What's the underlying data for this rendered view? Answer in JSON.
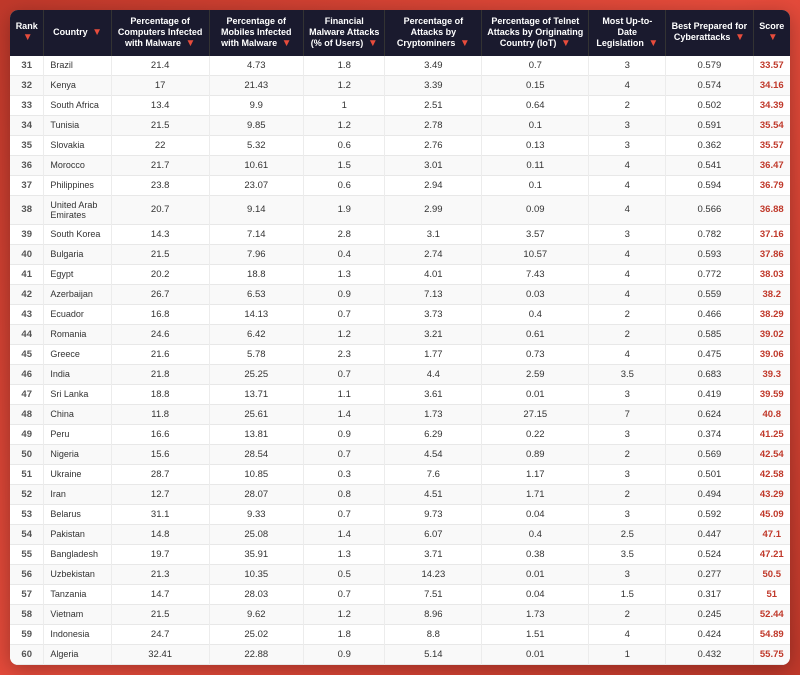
{
  "colors": {
    "header_bg": "#1a1a2e",
    "header_text": "#ffffff",
    "accent": "#e74c3c",
    "body_bg": "#ffffff",
    "alt_row": "#f9f9f9"
  },
  "columns": [
    {
      "key": "rank",
      "label": "Rank"
    },
    {
      "key": "country",
      "label": "Country"
    },
    {
      "key": "pct_malware",
      "label": "Percentage of Computers Infected with Malware"
    },
    {
      "key": "pct_mobile",
      "label": "Percentage of Mobiles Infected with Malware"
    },
    {
      "key": "fin_malware",
      "label": "Financial Malware Attacks (% of Users)"
    },
    {
      "key": "pct_cryptominer",
      "label": "Percentage of Attacks by Cryptominers"
    },
    {
      "key": "pct_telnet",
      "label": "Percentage of Telnet Attacks by Originating Country (IoT)"
    },
    {
      "key": "legislation",
      "label": "Most Up-to-Date Legislation"
    },
    {
      "key": "prepared",
      "label": "Best Prepared for Cyberattacks"
    },
    {
      "key": "score",
      "label": "Score"
    }
  ],
  "rows": [
    {
      "rank": 31,
      "country": "Brazil",
      "pct_malware": "21.4",
      "pct_mobile": "4.73",
      "fin_malware": "1.8",
      "pct_cryptominer": "3.49",
      "pct_telnet": "0.7",
      "legislation": "3",
      "prepared": "0.579",
      "score": "33.57"
    },
    {
      "rank": 32,
      "country": "Kenya",
      "pct_malware": "17",
      "pct_mobile": "21.43",
      "fin_malware": "1.2",
      "pct_cryptominer": "3.39",
      "pct_telnet": "0.15",
      "legislation": "4",
      "prepared": "0.574",
      "score": "34.16"
    },
    {
      "rank": 33,
      "country": "South Africa",
      "pct_malware": "13.4",
      "pct_mobile": "9.9",
      "fin_malware": "1",
      "pct_cryptominer": "2.51",
      "pct_telnet": "0.64",
      "legislation": "2",
      "prepared": "0.502",
      "score": "34.39"
    },
    {
      "rank": 34,
      "country": "Tunisia",
      "pct_malware": "21.5",
      "pct_mobile": "9.85",
      "fin_malware": "1.2",
      "pct_cryptominer": "2.78",
      "pct_telnet": "0.1",
      "legislation": "3",
      "prepared": "0.591",
      "score": "35.54"
    },
    {
      "rank": 35,
      "country": "Slovakia",
      "pct_malware": "22",
      "pct_mobile": "5.32",
      "fin_malware": "0.6",
      "pct_cryptominer": "2.76",
      "pct_telnet": "0.13",
      "legislation": "3",
      "prepared": "0.362",
      "score": "35.57"
    },
    {
      "rank": 36,
      "country": "Morocco",
      "pct_malware": "21.7",
      "pct_mobile": "10.61",
      "fin_malware": "1.5",
      "pct_cryptominer": "3.01",
      "pct_telnet": "0.11",
      "legislation": "4",
      "prepared": "0.541",
      "score": "36.47"
    },
    {
      "rank": 37,
      "country": "Philippines",
      "pct_malware": "23.8",
      "pct_mobile": "23.07",
      "fin_malware": "0.6",
      "pct_cryptominer": "2.94",
      "pct_telnet": "0.1",
      "legislation": "4",
      "prepared": "0.594",
      "score": "36.79"
    },
    {
      "rank": 38,
      "country": "United Arab Emirates",
      "pct_malware": "20.7",
      "pct_mobile": "9.14",
      "fin_malware": "1.9",
      "pct_cryptominer": "2.99",
      "pct_telnet": "0.09",
      "legislation": "4",
      "prepared": "0.566",
      "score": "36.88"
    },
    {
      "rank": 39,
      "country": "South Korea",
      "pct_malware": "14.3",
      "pct_mobile": "7.14",
      "fin_malware": "2.8",
      "pct_cryptominer": "3.1",
      "pct_telnet": "3.57",
      "legislation": "3",
      "prepared": "0.782",
      "score": "37.16"
    },
    {
      "rank": 40,
      "country": "Bulgaria",
      "pct_malware": "21.5",
      "pct_mobile": "7.96",
      "fin_malware": "0.4",
      "pct_cryptominer": "2.74",
      "pct_telnet": "10.57",
      "legislation": "4",
      "prepared": "0.593",
      "score": "37.86"
    },
    {
      "rank": 41,
      "country": "Egypt",
      "pct_malware": "20.2",
      "pct_mobile": "18.8",
      "fin_malware": "1.3",
      "pct_cryptominer": "4.01",
      "pct_telnet": "7.43",
      "legislation": "4",
      "prepared": "0.772",
      "score": "38.03"
    },
    {
      "rank": 42,
      "country": "Azerbaijan",
      "pct_malware": "26.7",
      "pct_mobile": "6.53",
      "fin_malware": "0.9",
      "pct_cryptominer": "7.13",
      "pct_telnet": "0.03",
      "legislation": "4",
      "prepared": "0.559",
      "score": "38.2"
    },
    {
      "rank": 43,
      "country": "Ecuador",
      "pct_malware": "16.8",
      "pct_mobile": "14.13",
      "fin_malware": "0.7",
      "pct_cryptominer": "3.73",
      "pct_telnet": "0.4",
      "legislation": "2",
      "prepared": "0.466",
      "score": "38.29"
    },
    {
      "rank": 44,
      "country": "Romania",
      "pct_malware": "24.6",
      "pct_mobile": "6.42",
      "fin_malware": "1.2",
      "pct_cryptominer": "3.21",
      "pct_telnet": "0.61",
      "legislation": "2",
      "prepared": "0.585",
      "score": "39.02"
    },
    {
      "rank": 45,
      "country": "Greece",
      "pct_malware": "21.6",
      "pct_mobile": "5.78",
      "fin_malware": "2.3",
      "pct_cryptominer": "1.77",
      "pct_telnet": "0.73",
      "legislation": "4",
      "prepared": "0.475",
      "score": "39.06"
    },
    {
      "rank": 46,
      "country": "India",
      "pct_malware": "21.8",
      "pct_mobile": "25.25",
      "fin_malware": "0.7",
      "pct_cryptominer": "4.4",
      "pct_telnet": "2.59",
      "legislation": "3.5",
      "prepared": "0.683",
      "score": "39.3"
    },
    {
      "rank": 47,
      "country": "Sri Lanka",
      "pct_malware": "18.8",
      "pct_mobile": "13.71",
      "fin_malware": "1.1",
      "pct_cryptominer": "3.61",
      "pct_telnet": "0.01",
      "legislation": "3",
      "prepared": "0.419",
      "score": "39.59"
    },
    {
      "rank": 48,
      "country": "China",
      "pct_malware": "11.8",
      "pct_mobile": "25.61",
      "fin_malware": "1.4",
      "pct_cryptominer": "1.73",
      "pct_telnet": "27.15",
      "legislation": "7",
      "prepared": "0.624",
      "score": "40.8"
    },
    {
      "rank": 49,
      "country": "Peru",
      "pct_malware": "16.6",
      "pct_mobile": "13.81",
      "fin_malware": "0.9",
      "pct_cryptominer": "6.29",
      "pct_telnet": "0.22",
      "legislation": "3",
      "prepared": "0.374",
      "score": "41.25"
    },
    {
      "rank": 50,
      "country": "Nigeria",
      "pct_malware": "15.6",
      "pct_mobile": "28.54",
      "fin_malware": "0.7",
      "pct_cryptominer": "4.54",
      "pct_telnet": "0.89",
      "legislation": "2",
      "prepared": "0.569",
      "score": "42.54"
    },
    {
      "rank": 51,
      "country": "Ukraine",
      "pct_malware": "28.7",
      "pct_mobile": "10.85",
      "fin_malware": "0.3",
      "pct_cryptominer": "7.6",
      "pct_telnet": "1.17",
      "legislation": "3",
      "prepared": "0.501",
      "score": "42.58"
    },
    {
      "rank": 52,
      "country": "Iran",
      "pct_malware": "12.7",
      "pct_mobile": "28.07",
      "fin_malware": "0.8",
      "pct_cryptominer": "4.51",
      "pct_telnet": "1.71",
      "legislation": "2",
      "prepared": "0.494",
      "score": "43.29"
    },
    {
      "rank": 53,
      "country": "Belarus",
      "pct_malware": "31.1",
      "pct_mobile": "9.33",
      "fin_malware": "0.7",
      "pct_cryptominer": "9.73",
      "pct_telnet": "0.04",
      "legislation": "3",
      "prepared": "0.592",
      "score": "45.09"
    },
    {
      "rank": 54,
      "country": "Pakistan",
      "pct_malware": "14.8",
      "pct_mobile": "25.08",
      "fin_malware": "1.4",
      "pct_cryptominer": "6.07",
      "pct_telnet": "0.4",
      "legislation": "2.5",
      "prepared": "0.447",
      "score": "47.1"
    },
    {
      "rank": 55,
      "country": "Bangladesh",
      "pct_malware": "19.7",
      "pct_mobile": "35.91",
      "fin_malware": "1.3",
      "pct_cryptominer": "3.71",
      "pct_telnet": "0.38",
      "legislation": "3.5",
      "prepared": "0.524",
      "score": "47.21"
    },
    {
      "rank": 56,
      "country": "Uzbekistan",
      "pct_malware": "21.3",
      "pct_mobile": "10.35",
      "fin_malware": "0.5",
      "pct_cryptominer": "14.23",
      "pct_telnet": "0.01",
      "legislation": "3",
      "prepared": "0.277",
      "score": "50.5"
    },
    {
      "rank": 57,
      "country": "Tanzania",
      "pct_malware": "14.7",
      "pct_mobile": "28.03",
      "fin_malware": "0.7",
      "pct_cryptominer": "7.51",
      "pct_telnet": "0.04",
      "legislation": "1.5",
      "prepared": "0.317",
      "score": "51"
    },
    {
      "rank": 58,
      "country": "Vietnam",
      "pct_malware": "21.5",
      "pct_mobile": "9.62",
      "fin_malware": "1.2",
      "pct_cryptominer": "8.96",
      "pct_telnet": "1.73",
      "legislation": "2",
      "prepared": "0.245",
      "score": "52.44"
    },
    {
      "rank": 59,
      "country": "Indonesia",
      "pct_malware": "24.7",
      "pct_mobile": "25.02",
      "fin_malware": "1.8",
      "pct_cryptominer": "8.8",
      "pct_telnet": "1.51",
      "legislation": "4",
      "prepared": "0.424",
      "score": "54.89"
    },
    {
      "rank": 60,
      "country": "Algeria",
      "pct_malware": "32.41",
      "pct_mobile": "22.88",
      "fin_malware": "0.9",
      "pct_cryptominer": "5.14",
      "pct_telnet": "0.01",
      "legislation": "1",
      "prepared": "0.432",
      "score": "55.75"
    }
  ]
}
